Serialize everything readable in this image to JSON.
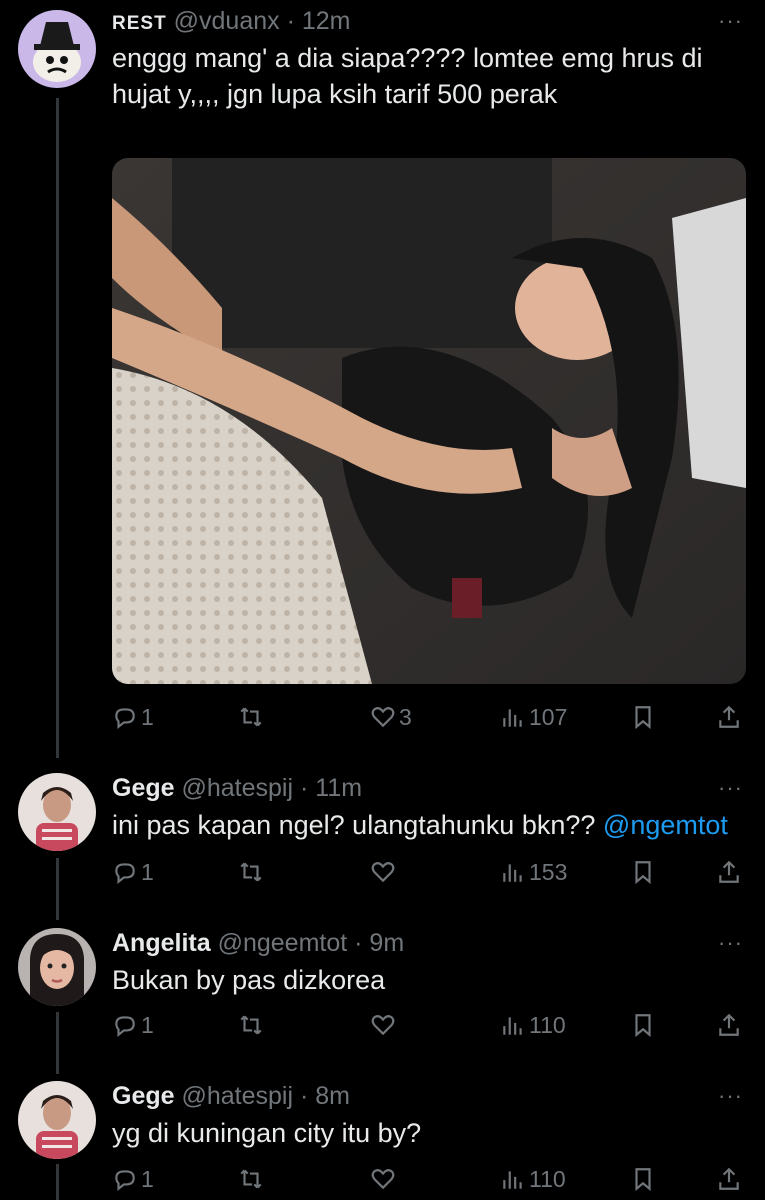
{
  "tweets": [
    {
      "name": "REST",
      "handle": "@vduanx",
      "time": "· 12m",
      "more": "···",
      "text": "enggg mang' a dia siapa???? lomtee emg hrus di hujat y,,,, jgn lupa ksih tarif 500 perak",
      "stats": {
        "replies": "1",
        "retweets": "",
        "likes": "3",
        "views": "107"
      }
    },
    {
      "name": "Gege",
      "handle": "@hatespij",
      "time": "· 11m",
      "more": "···",
      "text": "ini pas kapan ngel? ulangtahunku bkn??",
      "mention": "@ngemtot",
      "stats": {
        "replies": "1",
        "retweets": "",
        "likes": "",
        "views": "153"
      }
    },
    {
      "name": "Angelita",
      "handle": "@ngeemtot",
      "time": "· 9m",
      "more": "···",
      "text": "Bukan by pas dizkorea",
      "stats": {
        "replies": "1",
        "retweets": "",
        "likes": "",
        "views": "110"
      }
    },
    {
      "name": "Gege",
      "handle": "@hatespij",
      "time": "· 8m",
      "more": "···",
      "text": "yg di kuningan city itu by?",
      "stats": {
        "replies": "1",
        "retweets": "",
        "likes": "",
        "views": "110"
      }
    }
  ],
  "icons": {
    "reply": "reply-icon",
    "retweet": "retweet-icon",
    "like": "heart-icon",
    "views": "views-icon",
    "bookmark": "bookmark-icon",
    "share": "share-icon"
  },
  "colors": {
    "background": "#000000",
    "text": "#e7e9ea",
    "muted": "#71767b",
    "link": "#1d9bf0"
  }
}
